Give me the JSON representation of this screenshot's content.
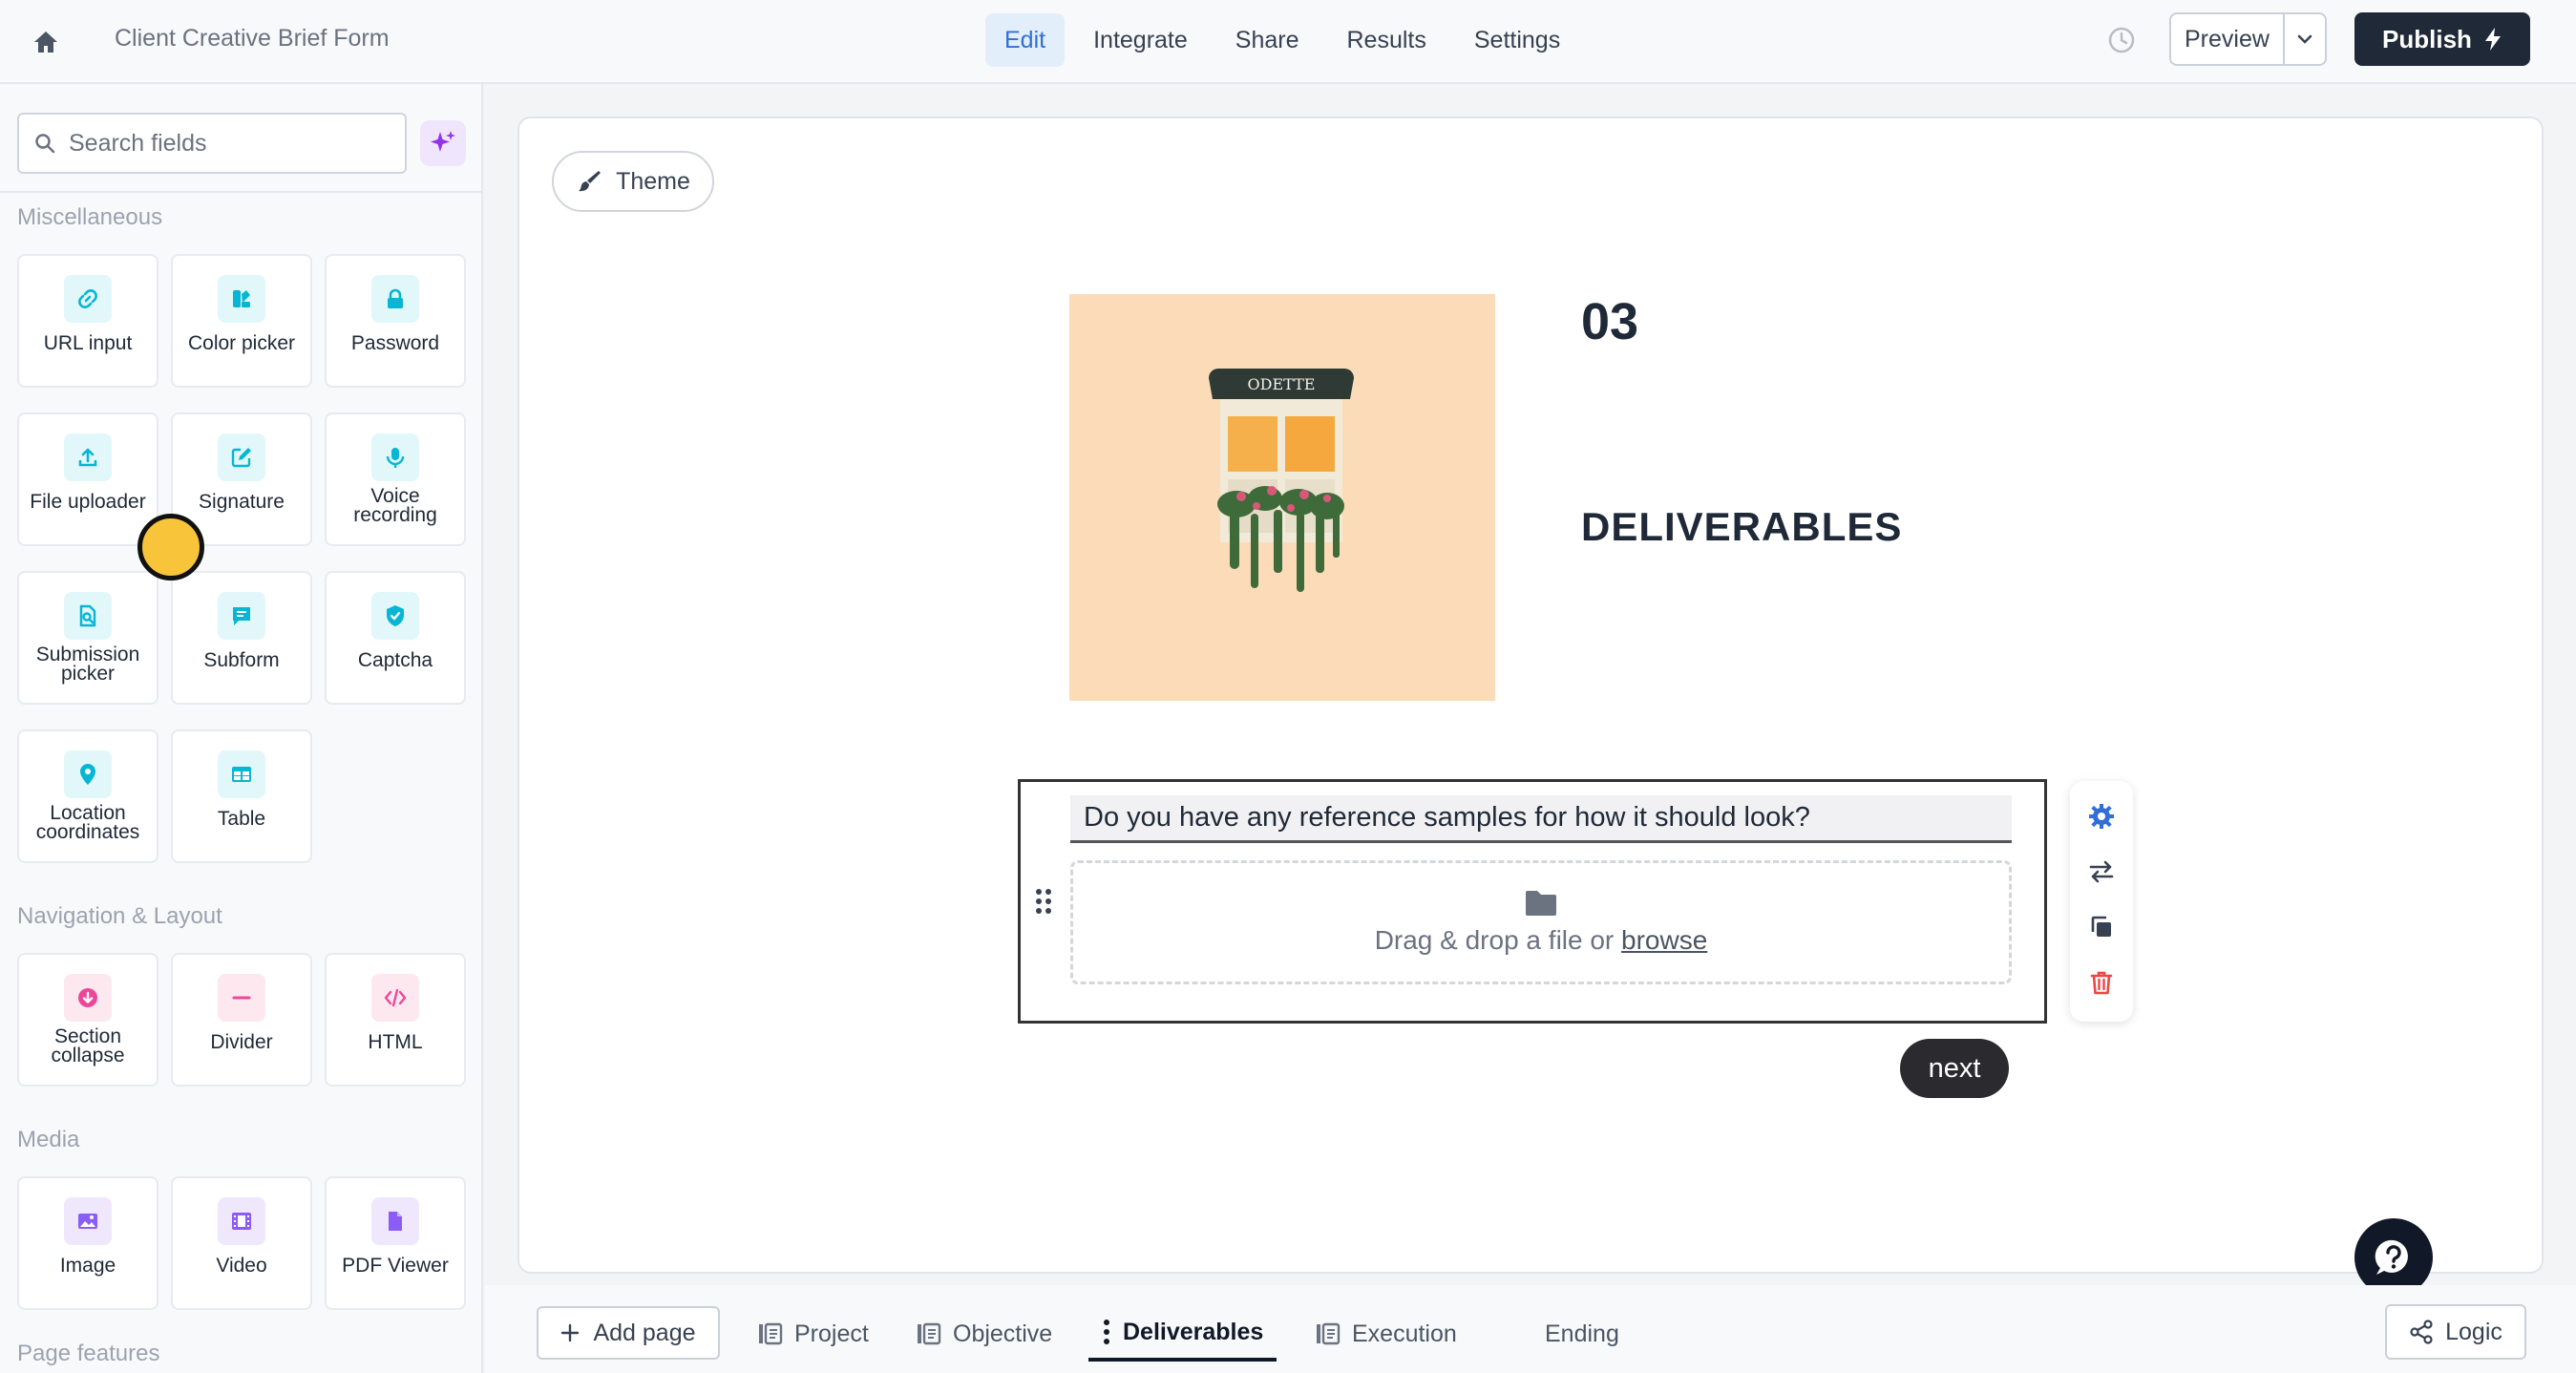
{
  "header": {
    "form_title": "Client Creative Brief Form",
    "tabs": [
      {
        "label": "Edit",
        "active": true
      },
      {
        "label": "Integrate"
      },
      {
        "label": "Share"
      },
      {
        "label": "Results"
      },
      {
        "label": "Settings"
      }
    ],
    "preview_label": "Preview",
    "publish_label": "Publish"
  },
  "sidebar": {
    "search_placeholder": "Search fields",
    "sections": {
      "misc": "Miscellaneous",
      "nav": "Navigation & Layout",
      "media": "Media",
      "page": "Page features"
    },
    "fields": {
      "url": "URL input",
      "color": "Color picker",
      "password": "Password",
      "file": "File uploader",
      "signature": "Signature",
      "voice": "Voice recording",
      "submission": "Submission picker",
      "subform": "Subform",
      "captcha": "Captcha",
      "location": "Location coordinates",
      "table": "Table",
      "section": "Section collapse",
      "divider": "Divider",
      "html": "HTML",
      "image": "Image",
      "video": "Video",
      "pdf": "PDF Viewer"
    }
  },
  "canvas": {
    "theme_label": "Theme",
    "image_sign_text": "ODETTE",
    "page_number": "03",
    "page_heading": "DELIVERABLES",
    "question": "Do you have any reference samples for how it should look?",
    "drop_prefix": "Drag & drop a file or ",
    "drop_link": "browse",
    "next_label": "next"
  },
  "footer": {
    "add_page": "Add page",
    "pages": [
      "Project",
      "Objective",
      "Deliverables",
      "Execution",
      "Ending"
    ],
    "active_page": "Deliverables",
    "logic_label": "Logic"
  },
  "colors": {
    "accent": "#2f6fd6",
    "publish_bg": "#1f2937",
    "cyan_icon": "#06b6d4",
    "pink_icon": "#ec4899",
    "violet_icon": "#8b5cf6",
    "delete_red": "#ef4444",
    "cursor_yellow": "#f8c43a"
  }
}
